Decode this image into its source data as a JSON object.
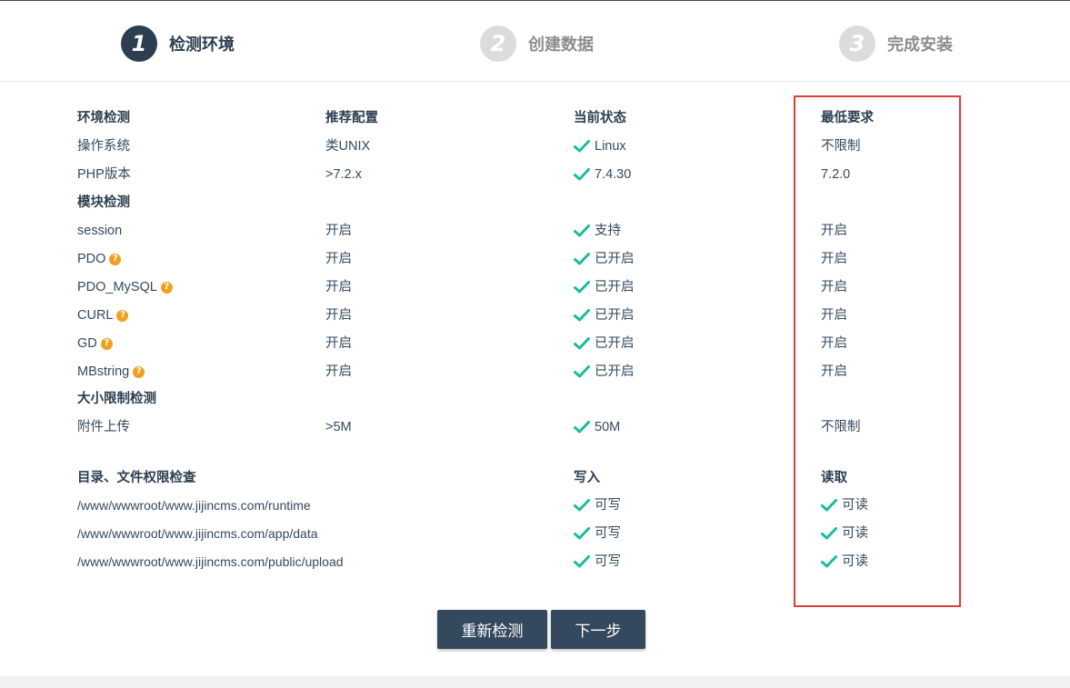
{
  "steps": [
    {
      "number": "1",
      "label": "检测环境",
      "active": true
    },
    {
      "number": "2",
      "label": "创建数据",
      "active": false
    },
    {
      "number": "3",
      "label": "完成安装",
      "active": false
    }
  ],
  "env_table": {
    "headers": [
      "环境检测",
      "推荐配置",
      "当前状态",
      "最低要求"
    ],
    "env_rows": [
      {
        "name": "操作系统",
        "recommended": "类UNIX",
        "current": "Linux",
        "minimum": "不限制"
      },
      {
        "name": "PHP版本",
        "recommended": ">7.2.x",
        "current": "7.4.30",
        "minimum": "7.2.0"
      }
    ],
    "module_section_title": "模块检测",
    "module_rows": [
      {
        "name": "session",
        "help": false,
        "recommended": "开启",
        "current": "支持",
        "minimum": "开启"
      },
      {
        "name": "PDO",
        "help": true,
        "recommended": "开启",
        "current": "已开启",
        "minimum": "开启"
      },
      {
        "name": "PDO_MySQL",
        "help": true,
        "recommended": "开启",
        "current": "已开启",
        "minimum": "开启"
      },
      {
        "name": "CURL",
        "help": true,
        "recommended": "开启",
        "current": "已开启",
        "minimum": "开启"
      },
      {
        "name": "GD",
        "help": true,
        "recommended": "开启",
        "current": "已开启",
        "minimum": "开启"
      },
      {
        "name": "MBstring",
        "help": true,
        "recommended": "开启",
        "current": "已开启",
        "minimum": "开启"
      }
    ],
    "size_section_title": "大小限制检测",
    "size_rows": [
      {
        "name": "附件上传",
        "recommended": ">5M",
        "current": "50M",
        "minimum": "不限制"
      }
    ]
  },
  "perm_table": {
    "headers": [
      "目录、文件权限检查",
      "写入",
      "读取"
    ],
    "rows": [
      {
        "path": "/www/wwwroot/www.jijincms.com/runtime",
        "write": "可写",
        "read": "可读"
      },
      {
        "path": "/www/wwwroot/www.jijincms.com/app/data",
        "write": "可写",
        "read": "可读"
      },
      {
        "path": "/www/wwwroot/www.jijincms.com/public/upload",
        "write": "可写",
        "read": "可读"
      }
    ]
  },
  "buttons": {
    "recheck": "重新检测",
    "next": "下一步"
  },
  "icons": {
    "check": "check-icon",
    "help": "question-circle-icon",
    "help_glyph": "?"
  },
  "colors": {
    "primary": "#34495e",
    "check": "#1abc9c",
    "help": "#f0a020",
    "highlight_border": "#e03c3c",
    "step_inactive": "#dcdcdc"
  }
}
